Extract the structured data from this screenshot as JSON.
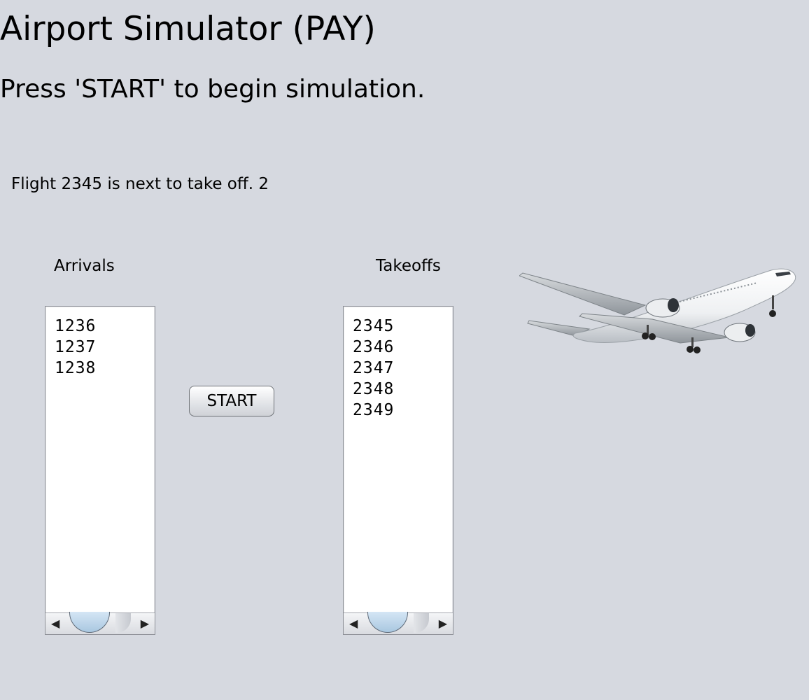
{
  "header": {
    "title": "Airport Simulator (PAY)",
    "subtitle": "Press 'START' to begin simulation."
  },
  "status": "Flight 2345 is next to take off. 2",
  "arrivals": {
    "label": "Arrivals",
    "items": [
      "1236",
      "1237",
      "1238"
    ]
  },
  "takeoffs": {
    "label": "Takeoffs",
    "items": [
      "2345",
      "2346",
      "2347",
      "2348",
      "2349"
    ]
  },
  "controls": {
    "start_label": "START"
  },
  "icons": {
    "scroll_left": "◀",
    "scroll_right": "▶",
    "image": "airplane-image"
  },
  "colors": {
    "background": "#d6d9e0",
    "scroll_thumb": "#a9c7e0"
  }
}
